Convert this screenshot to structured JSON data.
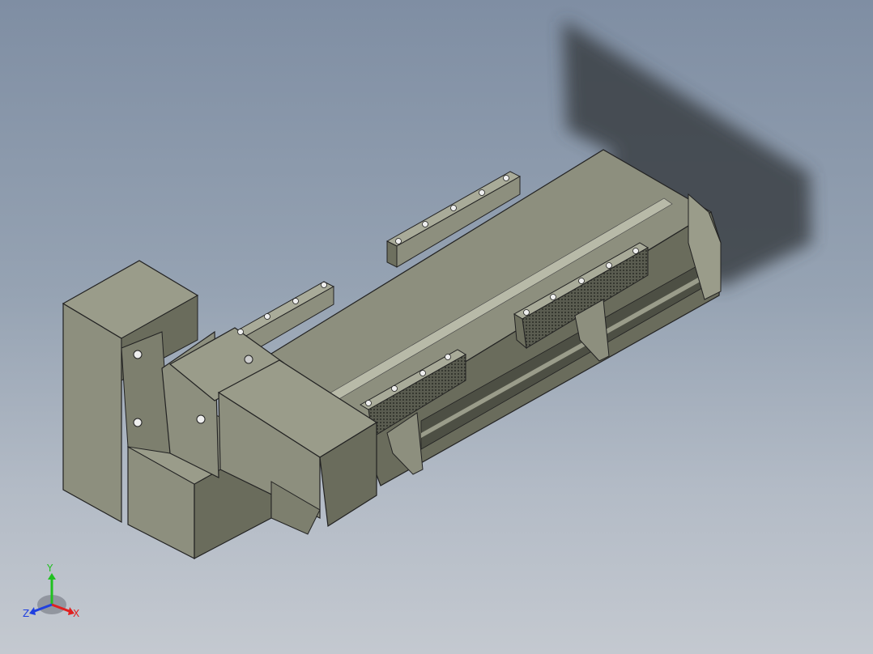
{
  "viewport": {
    "background_top": "#7f8ea3",
    "background_bottom": "#c4c9d0"
  },
  "model": {
    "body_color": "#8d8f7e",
    "body_dark": "#5f6153",
    "body_light": "#a9ab99",
    "shadow_color": "#3a3f44"
  },
  "triad": {
    "x_label": "X",
    "y_label": "Y",
    "z_label": "Z",
    "x_color": "#e02020",
    "y_color": "#20c020",
    "z_color": "#2040e0"
  }
}
